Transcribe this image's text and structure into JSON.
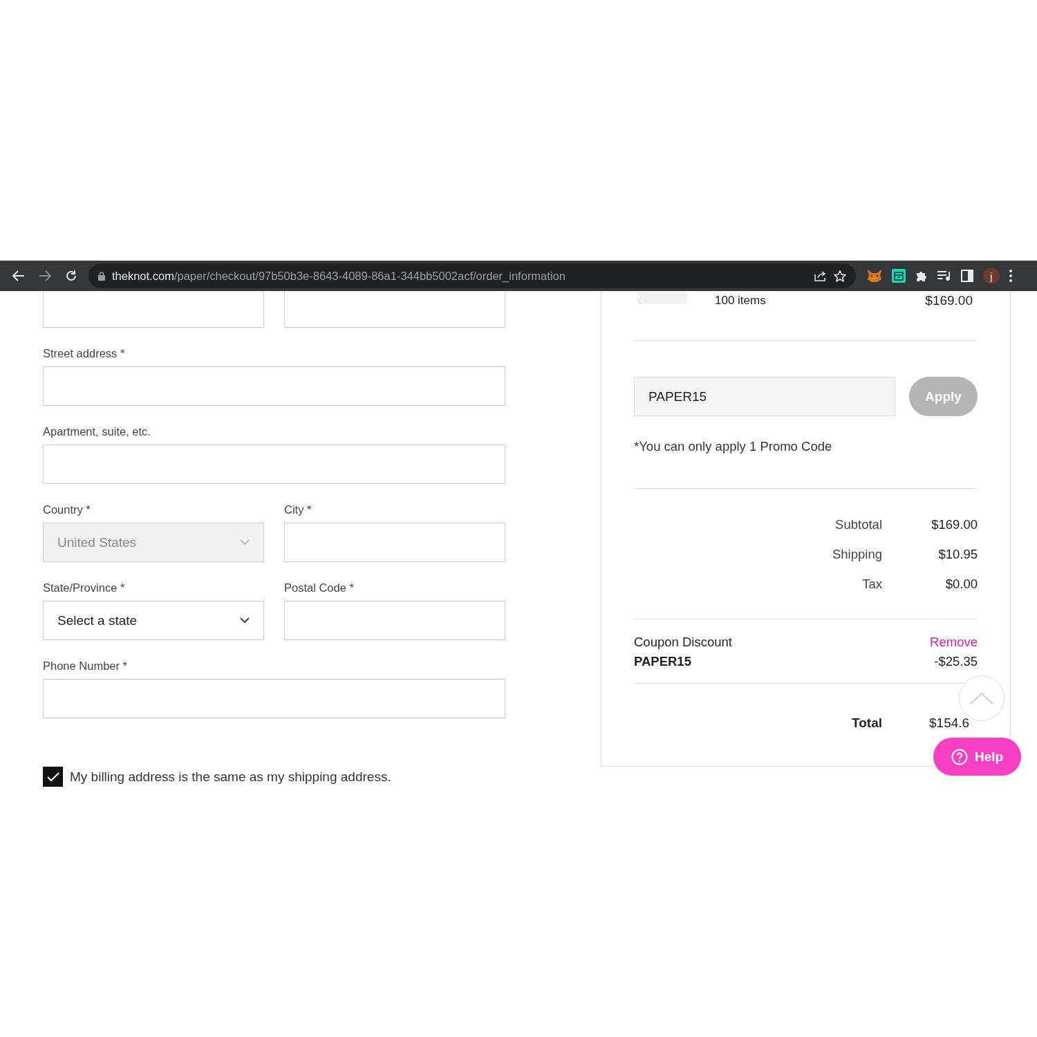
{
  "browser": {
    "back_disabled": false,
    "forward_disabled": true,
    "url_host": "theknot.com",
    "url_path": "/paper/checkout/97b50b3e-8643-4089-86a1-344bb5002acf/order_information",
    "profile_initial": "j"
  },
  "form": {
    "rows": [
      [
        {
          "kind": "input"
        },
        {
          "kind": "input"
        }
      ],
      [
        {
          "kind": "input",
          "label": "Street address *"
        }
      ],
      [
        {
          "kind": "input",
          "label": "Apartment, suite, etc."
        }
      ],
      [
        {
          "kind": "select",
          "label": "Country *",
          "value": "United States",
          "disabled": true
        },
        {
          "kind": "input",
          "label": "City *"
        }
      ],
      [
        {
          "kind": "select",
          "label": "State/Province *",
          "value": "Select a state",
          "disabled": false
        },
        {
          "kind": "input",
          "label": "Postal Code *"
        }
      ],
      [
        {
          "kind": "input",
          "label": "Phone Number *"
        }
      ]
    ],
    "billing_same": {
      "label": "My billing address is the same as my shipping address.",
      "checked": true
    }
  },
  "summary": {
    "item": {
      "count": "100 items",
      "price": "$169.00"
    },
    "promo": {
      "value": "PAPER15",
      "button": "Apply",
      "button_disabled": true,
      "note": "*You can only apply 1 Promo Code"
    },
    "lines": [
      {
        "label": "Subtotal",
        "value": "$169.00"
      },
      {
        "label": "Shipping",
        "value": "$10.95"
      },
      {
        "label": "Tax",
        "value": "$0.00"
      }
    ],
    "coupon": {
      "label": "Coupon Discount",
      "code": "PAPER15",
      "action": "Remove",
      "amount": "-$25.35"
    },
    "total": {
      "label": "Total",
      "value": "$154.6"
    }
  },
  "help": {
    "label": "Help"
  }
}
